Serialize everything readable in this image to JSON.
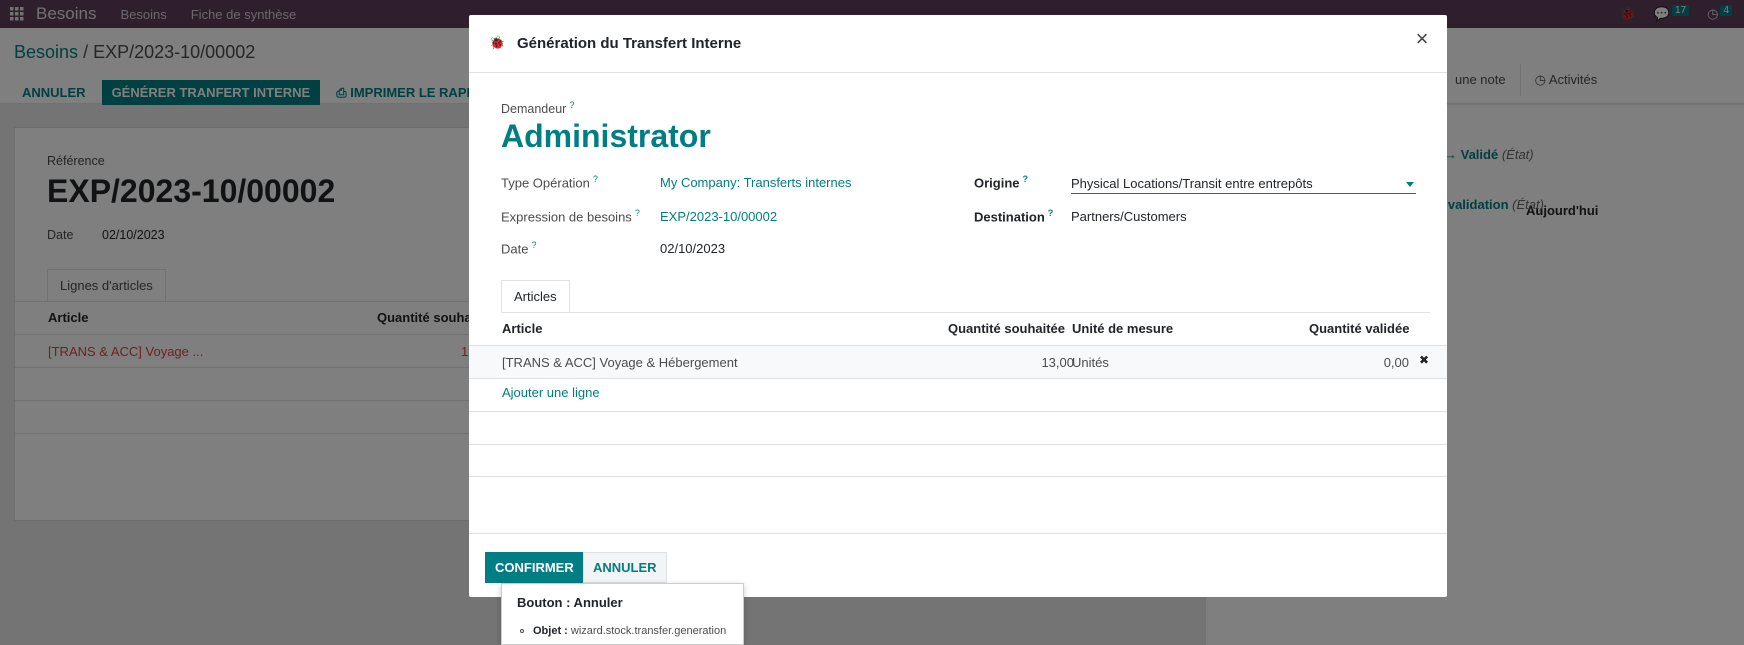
{
  "navbar": {
    "app_name": "Besoins",
    "menu": [
      "Besoins",
      "Fiche de synthèse"
    ],
    "messages_count": "17",
    "activities_count": "4"
  },
  "background": {
    "breadcrumb_parent": "Besoins",
    "breadcrumb_sep": "/",
    "breadcrumb_current": "EXP/2023-10/00002",
    "btn_cancel": "ANNULER",
    "btn_generate": "GÉNÉRER TRANFERT INTERNE",
    "btn_print": "IMPRIMER LE RAPPOR",
    "chatter_note": "une note",
    "chatter_activities": "Activités",
    "ref_label": "Référence",
    "ref_value": "EXP/2023-10/00002",
    "date_label": "Date",
    "date_value": "02/10/2023",
    "tab_lines": "Lignes d'articles",
    "col_article": "Article",
    "col_qty": "Quantité souha",
    "row_article": "[TRANS & ACC] Voyage ...",
    "row_qty": "1",
    "chatter_day": "Aujourd'hui",
    "chatter_ev1": "Validé",
    "chatter_ev1_state": "(État)",
    "chatter_ev2": "e validation",
    "chatter_ev2_state": "(État)"
  },
  "modal": {
    "title": "Génération du Transfert Interne",
    "requester_label": "Demandeur",
    "requester_value": "Administrator",
    "fields": {
      "op_type_label": "Type Opération",
      "op_type_value": "My Company: Transferts internes",
      "expression_label": "Expression de besoins",
      "expression_value": "EXP/2023-10/00002",
      "date_label": "Date",
      "date_value": "02/10/2023",
      "origin_label": "Origine",
      "origin_value": "Physical Locations/Transit entre entrepôts",
      "destination_label": "Destination",
      "destination_value": "Partners/Customers"
    },
    "tab": "Articles",
    "table": {
      "headers": [
        "Article",
        "Quantité souhaitée",
        "Unité de mesure",
        "Quantité validée"
      ],
      "rows": [
        {
          "article": "[TRANS & ACC] Voyage & Hébergement",
          "qty": "13,00",
          "uom": "Unités",
          "validated": "0,00"
        }
      ],
      "add_line": "Ajouter une ligne"
    },
    "btn_confirm": "CONFIRMER",
    "btn_cancel": "ANNULER"
  },
  "tooltip": {
    "title": "Bouton : Annuler",
    "object_label": "Objet :",
    "object_value": "wizard.stock.transfer.generation"
  },
  "colors": {
    "navbar": "#5e3d57",
    "primary": "#017e84"
  }
}
